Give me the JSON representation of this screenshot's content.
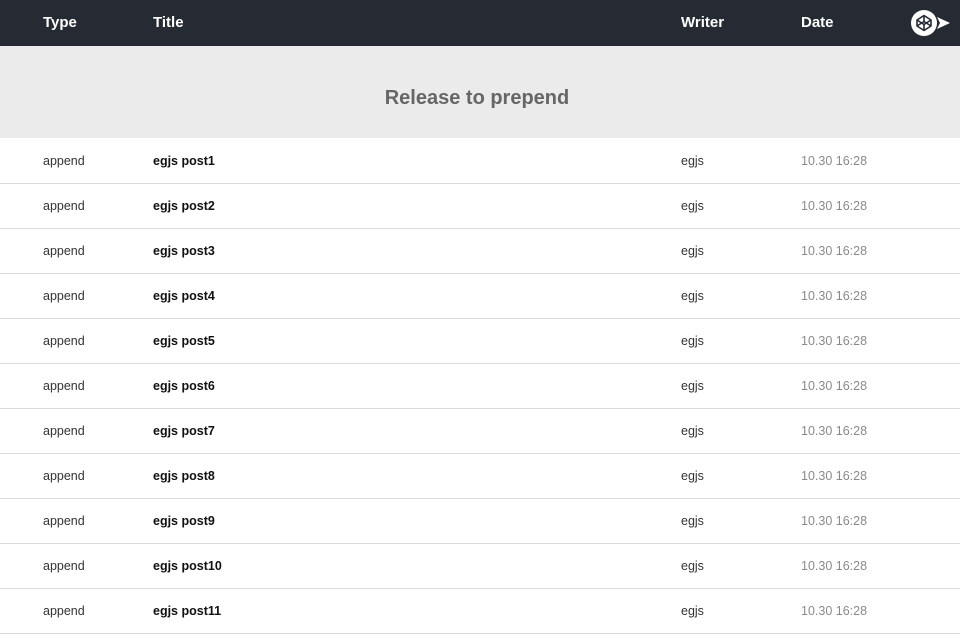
{
  "header": {
    "columns": {
      "type": "Type",
      "title": "Title",
      "writer": "Writer",
      "date": "Date"
    },
    "codepen_icon": "codepen-logo-arrow-icon"
  },
  "pull_indicator": {
    "text": "Release to prepend"
  },
  "rows": [
    {
      "type": "append",
      "title": "egjs post1",
      "writer": "egjs",
      "date": "10.30 16:28"
    },
    {
      "type": "append",
      "title": "egjs post2",
      "writer": "egjs",
      "date": "10.30 16:28"
    },
    {
      "type": "append",
      "title": "egjs post3",
      "writer": "egjs",
      "date": "10.30 16:28"
    },
    {
      "type": "append",
      "title": "egjs post4",
      "writer": "egjs",
      "date": "10.30 16:28"
    },
    {
      "type": "append",
      "title": "egjs post5",
      "writer": "egjs",
      "date": "10.30 16:28"
    },
    {
      "type": "append",
      "title": "egjs post6",
      "writer": "egjs",
      "date": "10.30 16:28"
    },
    {
      "type": "append",
      "title": "egjs post7",
      "writer": "egjs",
      "date": "10.30 16:28"
    },
    {
      "type": "append",
      "title": "egjs post8",
      "writer": "egjs",
      "date": "10.30 16:28"
    },
    {
      "type": "append",
      "title": "egjs post9",
      "writer": "egjs",
      "date": "10.30 16:28"
    },
    {
      "type": "append",
      "title": "egjs post10",
      "writer": "egjs",
      "date": "10.30 16:28"
    },
    {
      "type": "append",
      "title": "egjs post11",
      "writer": "egjs",
      "date": "10.30 16:28"
    }
  ],
  "colors": {
    "header_bg": "#252a33",
    "pull_bg": "#ebebeb",
    "pull_text": "#666666",
    "date_text": "#8a8a8a",
    "row_divider": "#dcdcdc"
  }
}
